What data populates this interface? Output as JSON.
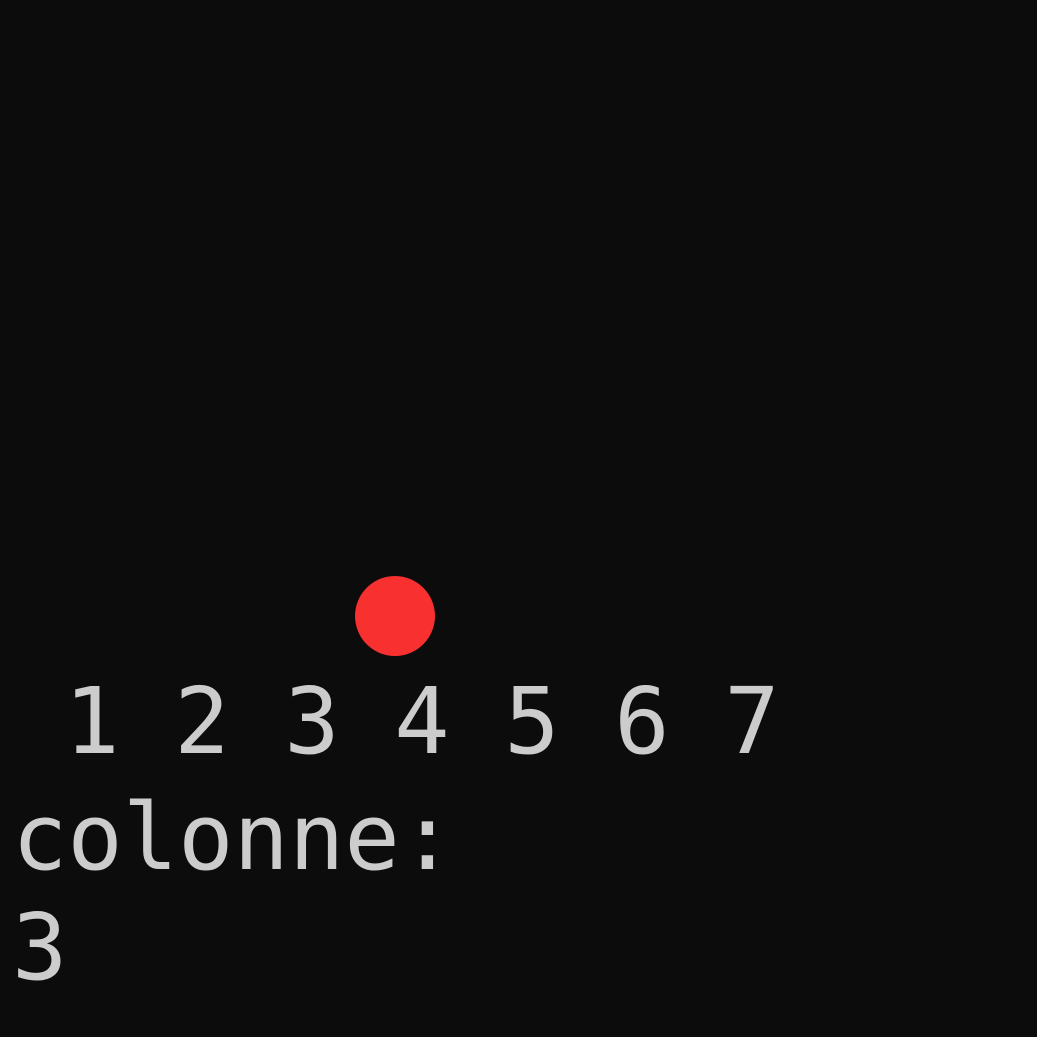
{
  "board": {
    "piece_color": "#f83030",
    "pieces": [
      {
        "column": 4,
        "color": "red"
      }
    ],
    "column_numbers": [
      "1",
      "2",
      "3",
      "4",
      "5",
      "6",
      "7"
    ]
  },
  "prompt": {
    "label": "colonne:",
    "input_value": "3"
  },
  "theme": {
    "background": "#0c0c0c",
    "text_color": "#cccccc"
  }
}
